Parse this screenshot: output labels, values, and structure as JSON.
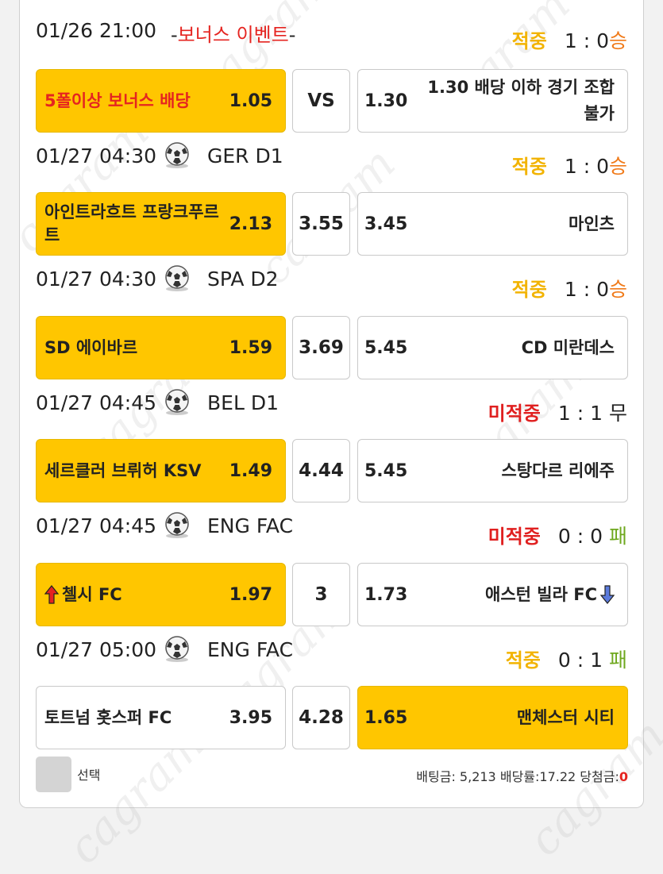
{
  "colors": {
    "selected": "#ffc600",
    "hit": "#f2b300",
    "miss": "#e02020",
    "win": "#f07a19",
    "lose": "#6fa81f",
    "bonus_red": "#e52420"
  },
  "watermark": "cagram",
  "header0": {
    "time": "01/26 21:00",
    "bonus_dash_left": "-",
    "bonus_text": "보너스 이벤트",
    "bonus_dash_right": "-",
    "result": "적중",
    "score": "1 : 0",
    "outcome": "승"
  },
  "bonus_row": {
    "name": "5폴이상 보너스 배당",
    "odds_left": "1.05",
    "mid": "VS",
    "odds_right": "1.30",
    "note": "1.30 배당 이하 경기 조합 불가"
  },
  "matches": [
    {
      "time": "01/27 04:30",
      "icon": "soccer-ball-icon",
      "league": "GER D1",
      "result": "적중",
      "score": "1 : 0",
      "outcome": "승",
      "home": "아인트라흐트 프랑크푸르트",
      "home_odds": "2.13",
      "mid": "3.55",
      "away_odds": "3.45",
      "away": "마인츠"
    },
    {
      "time": "01/27 04:30",
      "icon": "soccer-ball-icon",
      "league": "SPA D2",
      "result": "적중",
      "score": "1 : 0",
      "outcome": "승",
      "home": "SD 에이바르",
      "home_odds": "1.59",
      "mid": "3.69",
      "away_odds": "5.45",
      "away": "CD 미란데스"
    },
    {
      "time": "01/27 04:45",
      "icon": "soccer-ball-icon",
      "league": "BEL D1",
      "result": "미적중",
      "score": "1 : 1",
      "outcome": "무",
      "home": "세르클러 브뤼허 KSV",
      "home_odds": "1.49",
      "mid": "4.44",
      "away_odds": "5.45",
      "away": "스탕다르 리에주"
    },
    {
      "time": "01/27 04:45",
      "icon": "soccer-ball-icon",
      "league": "ENG FAC",
      "result": "미적중",
      "score": "0 : 0",
      "outcome": "패",
      "home": "첼시 FC",
      "home_odds": "1.97",
      "mid": "3",
      "away_odds": "1.73",
      "away": "애스턴 빌라 FC"
    },
    {
      "time": "01/27 05:00",
      "icon": "soccer-ball-icon",
      "league": "ENG FAC",
      "result": "적중",
      "score": "0 : 1",
      "outcome": "패",
      "home": "토트넘 홋스퍼 FC",
      "home_odds": "3.95",
      "mid": "4.28",
      "away_odds": "1.65",
      "away": "맨체스터 시티"
    }
  ],
  "footer": {
    "select_label": "선택",
    "bet_label": "배팅금: 5,213",
    "rate_label": "배당률:17.22",
    "win_label": "당첨금:",
    "win_value": "0"
  }
}
